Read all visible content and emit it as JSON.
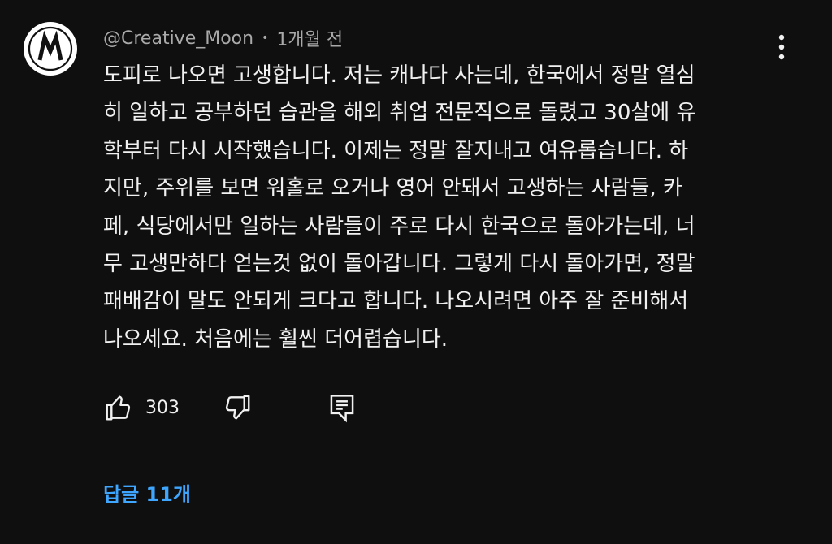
{
  "comment": {
    "author": "@Creative_Moon",
    "separator": "•",
    "time": "1개월 전",
    "avatar_letter": "M",
    "text_lines": [
      "도피로 나오면 고생합니다. 저는 캐나다 사는데, 한국에서 정말 열심",
      "히 일하고 공부하던 습관을 해외 취업 전문직으로 돌렸고 30살에 유",
      "학부터 다시 시작했습니다. 이제는 정말 잘지내고 여유롭습니다. 하",
      "지만, 주위를 보면 워홀로 오거나 영어 안돼서 고생하는 사람들, 카",
      "페, 식당에서만 일하는 사람들이 주로 다시 한국으로 돌아가는데, 너",
      "무 고생만하다 얻는것 없이 돌아갑니다. 그렇게 다시 돌아가면, 정말",
      "패배감이 말도 안되게 크다고 합니다. 나오시려면 아주 잘 준비해서",
      "나오세요. 처음에는 훨씬 더어렵습니다."
    ],
    "like_count": "303",
    "replies_label": "답글 11개"
  },
  "icons": {
    "more": "more-vert-icon",
    "like": "thumbs-up-icon",
    "dislike": "thumbs-down-icon",
    "reply": "reply-icon"
  },
  "colors": {
    "background": "#0f0f0f",
    "text": "#f1f1f1",
    "meta": "#aaaaaa",
    "link": "#3ea6ff"
  }
}
